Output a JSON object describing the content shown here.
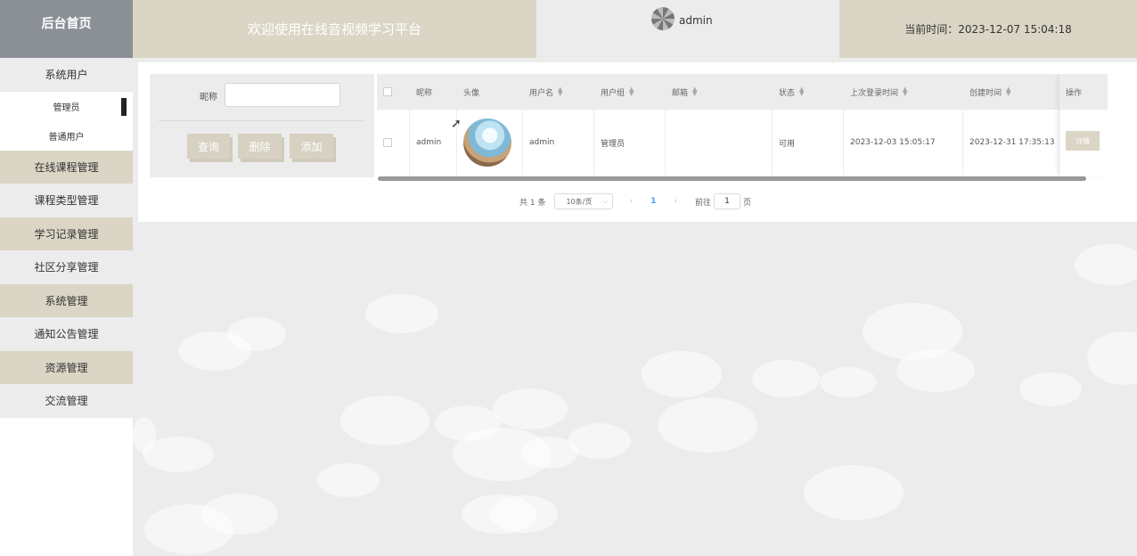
{
  "header": {
    "brand": "后台首页",
    "welcome": "欢迎使用在线音视频学习平台",
    "username": "admin",
    "time": "当前时间：2023-12-07 15:04:18"
  },
  "sidebar": {
    "items": [
      {
        "label": "系统用户"
      },
      {
        "label": "管理员"
      },
      {
        "label": "普通用户"
      },
      {
        "label": "在线课程管理"
      },
      {
        "label": "课程类型管理"
      },
      {
        "label": "学习记录管理"
      },
      {
        "label": "社区分享管理"
      },
      {
        "label": "系统管理"
      },
      {
        "label": "通知公告管理"
      },
      {
        "label": "资源管理"
      },
      {
        "label": "交流管理"
      }
    ]
  },
  "search": {
    "label": "昵称",
    "value": "",
    "placeholder": "",
    "buttons": {
      "query": "查询",
      "delete": "删除",
      "add": "添加"
    }
  },
  "table": {
    "headers": {
      "nickname": "昵称",
      "avatar": "头像",
      "username": "用户名",
      "group": "用户组",
      "email": "邮箱",
      "status": "状态",
      "last_login": "上次登录时间",
      "created": "创建时间",
      "ops": "操作"
    },
    "rows": [
      {
        "nickname": "admin",
        "username": "admin",
        "group": "管理员",
        "email": "",
        "status": "可用",
        "last_login": "2023-12-03 15:05:17",
        "created": "2023-12-31 17:35:13",
        "detail": "详情"
      }
    ]
  },
  "pagination": {
    "total": "共 1 条",
    "page_size": "10条/页",
    "current": "1",
    "goto_label": "前往",
    "goto_value": "1",
    "page_suffix": "页"
  },
  "colors": {
    "beige": "#dad5c5",
    "brand_gray": "#8b9097",
    "background": "#ececec",
    "accent_blue": "#409eff"
  }
}
